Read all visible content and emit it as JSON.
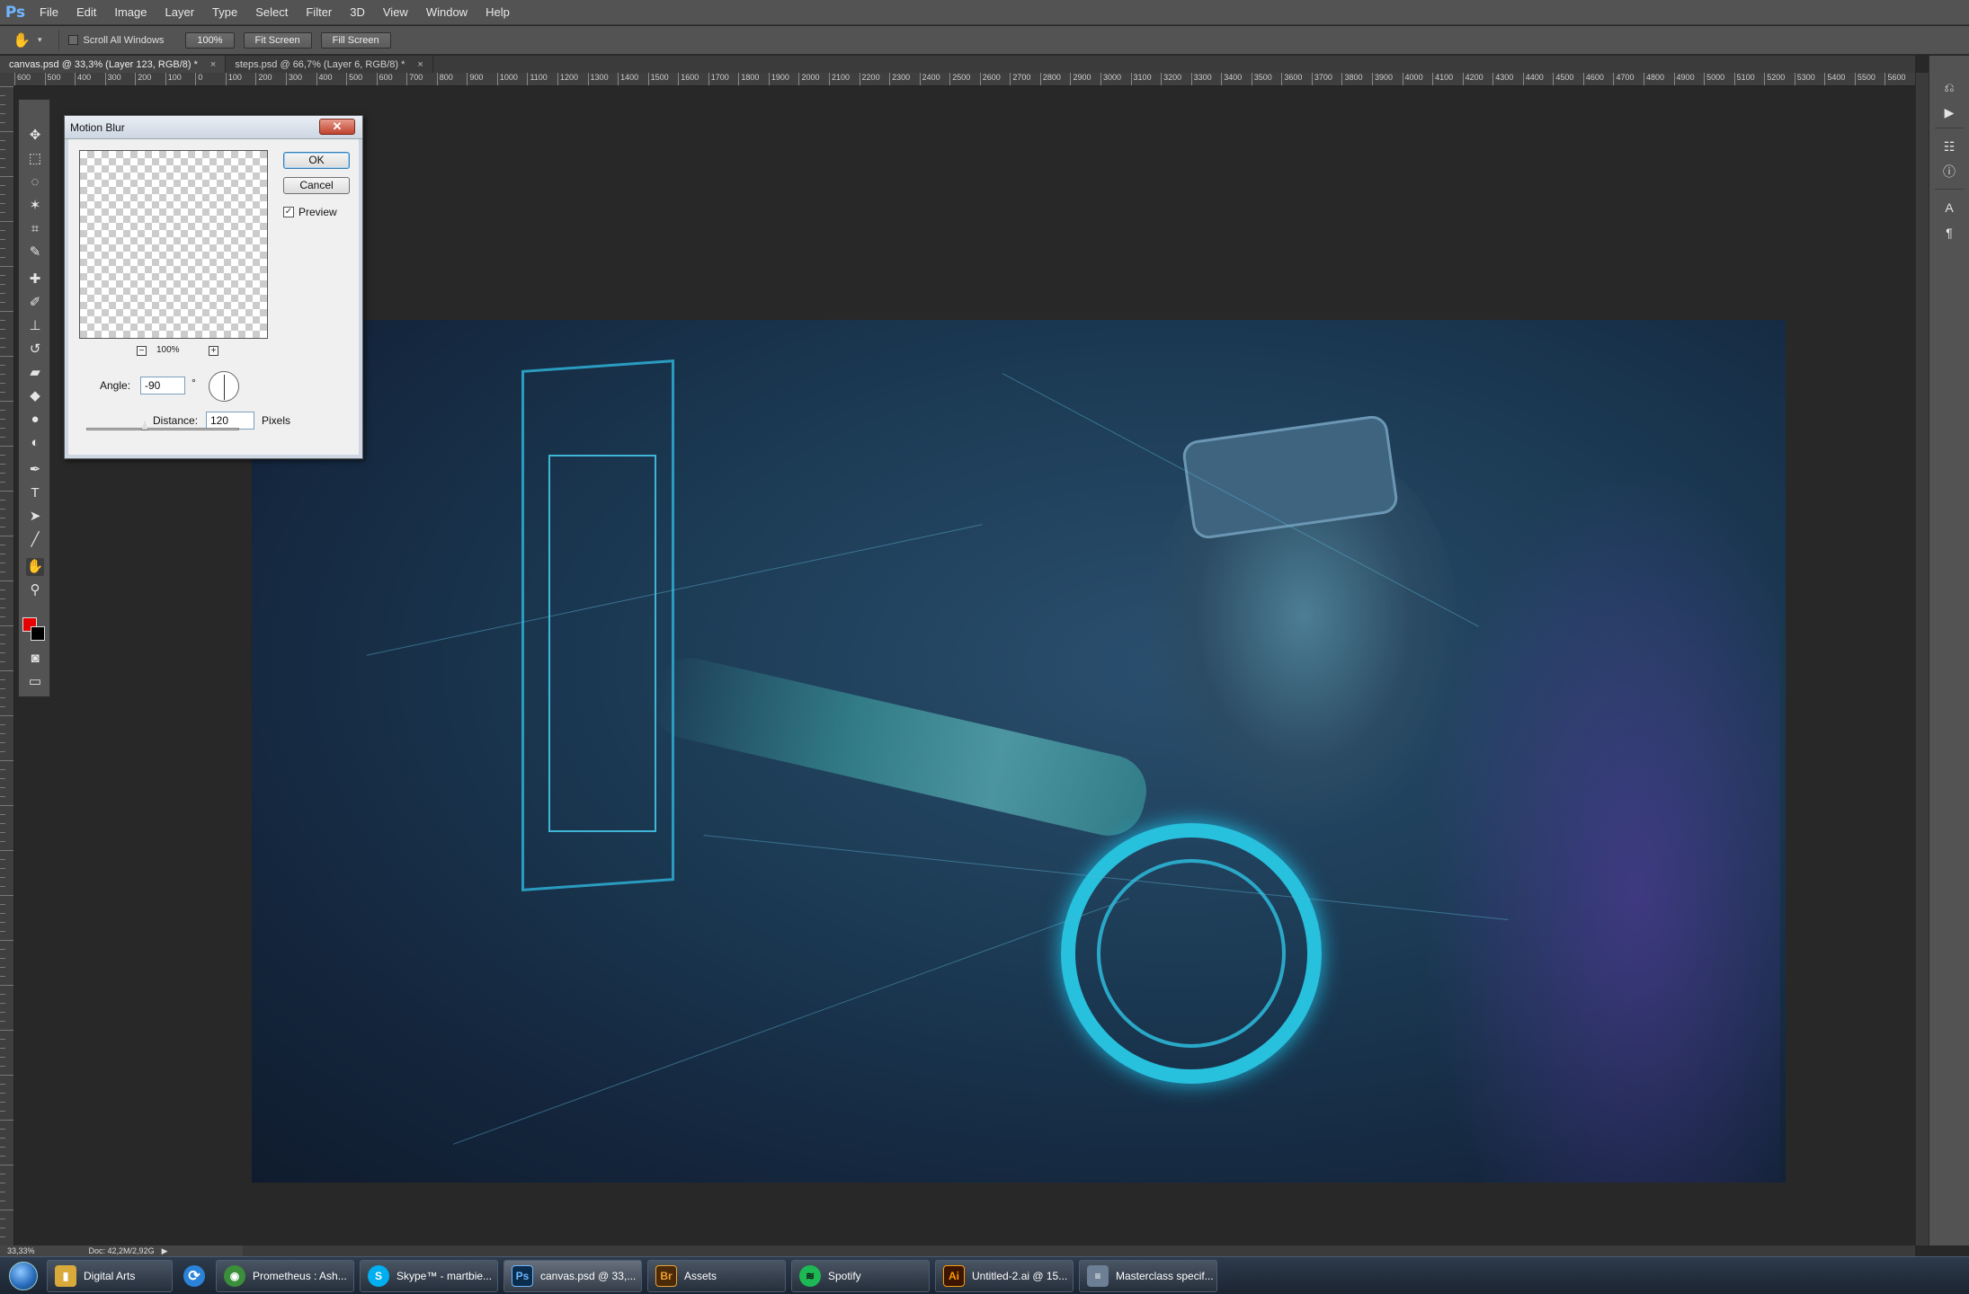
{
  "app": {
    "logo": "Ps"
  },
  "menu": [
    "File",
    "Edit",
    "Image",
    "Layer",
    "Type",
    "Select",
    "Filter",
    "3D",
    "View",
    "Window",
    "Help"
  ],
  "options": {
    "scroll_all_label": "Scroll All Windows",
    "btn_100": "100%",
    "btn_fit": "Fit Screen",
    "btn_fill": "Fill Screen"
  },
  "tabs": [
    {
      "label": "canvas.psd @ 33,3% (Layer 123, RGB/8) *",
      "close": "×"
    },
    {
      "label": "steps.psd @ 66,7% (Layer 6, RGB/8) *",
      "close": "×"
    }
  ],
  "ruler": [
    "600",
    "500",
    "400",
    "300",
    "200",
    "100",
    "0",
    "100",
    "200",
    "300",
    "400",
    "500",
    "600",
    "700",
    "800",
    "900",
    "1000",
    "1100",
    "1200",
    "1300",
    "1400",
    "1500",
    "1600",
    "1700",
    "1800",
    "1900",
    "2000",
    "2100",
    "2200",
    "2300",
    "2400",
    "2500",
    "2600",
    "2700",
    "2800",
    "2900",
    "3000",
    "3100",
    "3200",
    "3300",
    "3400",
    "3500",
    "3600",
    "3700",
    "3800",
    "3900",
    "4000",
    "4100",
    "4200",
    "4300",
    "4400",
    "4500",
    "4600",
    "4700",
    "4800",
    "4900",
    "5000",
    "5100",
    "5200",
    "5300",
    "5400",
    "5500",
    "5600"
  ],
  "dialog": {
    "title": "Motion Blur",
    "close": "✕",
    "ok": "OK",
    "cancel": "Cancel",
    "preview_label": "Preview",
    "preview_checked": true,
    "zoom_minus": "−",
    "zoom_plus": "+",
    "zoom_level": "100%",
    "angle_label": "Angle:",
    "angle_value": "-90",
    "degree": "°",
    "distance_label": "Distance:",
    "distance_value": "120",
    "unit": "Pixels"
  },
  "status": {
    "zoom": "33,33%",
    "doc": "Doc: 42,2M/2,92G"
  },
  "taskbar": [
    {
      "label": "Digital Arts",
      "icon": "folder-icon",
      "color": "#d9a93a",
      "glyph": "▮"
    },
    {
      "label": "",
      "icon": "refresh-icon",
      "color": "#2b82d9",
      "glyph": "⟳"
    },
    {
      "label": "Prometheus : Ash...",
      "icon": "chrome-icon",
      "color": "#3b8f3b",
      "glyph": "◉"
    },
    {
      "label": "Skype™ - martbie...",
      "icon": "skype-icon",
      "color": "#00aff0",
      "glyph": "S"
    },
    {
      "label": "canvas.psd @ 33,...",
      "icon": "photoshop-icon",
      "color": "#0b2c4d",
      "glyph": "Ps"
    },
    {
      "label": "Assets",
      "icon": "bridge-icon",
      "color": "#4a2a08",
      "glyph": "Br"
    },
    {
      "label": "Spotify",
      "icon": "spotify-icon",
      "color": "#1db954",
      "glyph": "≋"
    },
    {
      "label": "Untitled-2.ai @ 15...",
      "icon": "illustrator-icon",
      "color": "#3b1402",
      "glyph": "Ai"
    },
    {
      "label": "Masterclass specif...",
      "icon": "document-icon",
      "color": "#6d7f95",
      "glyph": "≡"
    }
  ]
}
